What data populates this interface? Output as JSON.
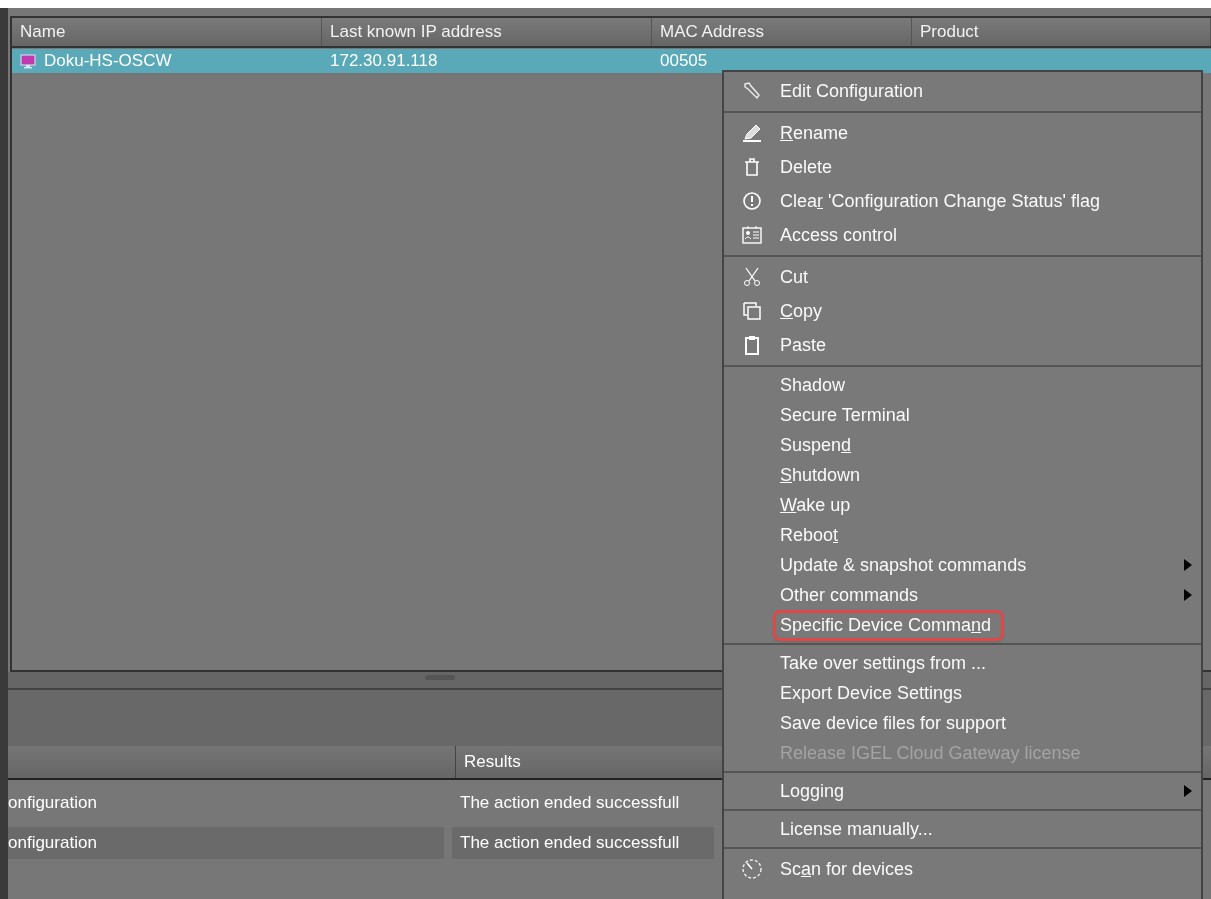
{
  "table": {
    "columns": [
      "Name",
      "Last known IP address",
      "MAC Address",
      "Product"
    ],
    "rows": [
      {
        "name": "Doku-HS-OSCW",
        "ip": "172.30.91.118",
        "mac": "00505",
        "selected": true
      }
    ]
  },
  "results": {
    "columns": [
      "Results"
    ],
    "rows": [
      {
        "action": "onfiguration",
        "result": "The action ended successfull",
        "selected": false
      },
      {
        "action": "onfiguration",
        "result": "The action ended successfull",
        "selected": true
      }
    ]
  },
  "context_menu": {
    "sections": [
      [
        {
          "text": "Edit Configuration",
          "kind": "icon",
          "disabled": false,
          "submenu": false,
          "highlighted": false
        }
      ],
      [
        {
          "text": "Rename",
          "kind": "icon",
          "disabled": false,
          "submenu": false,
          "highlighted": false
        },
        {
          "text": "Delete",
          "kind": "icon",
          "disabled": false,
          "submenu": false,
          "highlighted": false
        },
        {
          "text": "Clear 'Configuration Change Status' flag",
          "kind": "icon",
          "disabled": false,
          "submenu": false,
          "highlighted": false
        },
        {
          "text": "Access control",
          "kind": "icon",
          "disabled": false,
          "submenu": false,
          "highlighted": false
        }
      ],
      [
        {
          "text": "Cut",
          "kind": "icon",
          "disabled": false,
          "submenu": false,
          "highlighted": false
        },
        {
          "text": "Copy",
          "kind": "icon",
          "disabled": false,
          "submenu": false,
          "highlighted": false
        },
        {
          "text": "Paste",
          "kind": "icon",
          "disabled": false,
          "submenu": false,
          "highlighted": false
        }
      ],
      [
        {
          "text": "Shadow",
          "kind": "plain",
          "disabled": false,
          "submenu": false,
          "highlighted": false
        },
        {
          "text": "Secure Terminal",
          "kind": "plain",
          "disabled": false,
          "submenu": false,
          "highlighted": false
        },
        {
          "text": "Suspend",
          "kind": "plain",
          "disabled": false,
          "submenu": false,
          "highlighted": false
        },
        {
          "text": "Shutdown",
          "kind": "plain",
          "disabled": false,
          "submenu": false,
          "highlighted": false
        },
        {
          "text": "Wake up",
          "kind": "plain",
          "disabled": false,
          "submenu": false,
          "highlighted": false
        },
        {
          "text": "Reboot",
          "kind": "plain",
          "disabled": false,
          "submenu": false,
          "highlighted": false
        },
        {
          "text": "Update & snapshot commands",
          "kind": "plain",
          "disabled": false,
          "submenu": true,
          "highlighted": false
        },
        {
          "text": "Other commands",
          "kind": "plain",
          "disabled": false,
          "submenu": true,
          "highlighted": false
        },
        {
          "text": "Specific Device Command",
          "kind": "plain",
          "disabled": false,
          "submenu": false,
          "highlighted": true
        }
      ],
      [
        {
          "text": "Take over settings from ...",
          "kind": "plain",
          "disabled": false,
          "submenu": false,
          "highlighted": false
        },
        {
          "text": "Export Device Settings",
          "kind": "plain",
          "disabled": false,
          "submenu": false,
          "highlighted": false
        },
        {
          "text": "Save device files for support",
          "kind": "plain",
          "disabled": false,
          "submenu": false,
          "highlighted": false
        },
        {
          "text": "Release IGEL Cloud Gateway license",
          "kind": "plain",
          "disabled": true,
          "submenu": false,
          "highlighted": false
        }
      ],
      [
        {
          "text": "Logging",
          "kind": "plain",
          "disabled": false,
          "submenu": true,
          "highlighted": false
        }
      ],
      [
        {
          "text": "License manually...",
          "kind": "plain",
          "disabled": false,
          "submenu": false,
          "highlighted": false
        }
      ],
      [
        {
          "text": "Scan for devices",
          "kind": "icon",
          "disabled": false,
          "submenu": false,
          "highlighted": false
        }
      ]
    ]
  }
}
